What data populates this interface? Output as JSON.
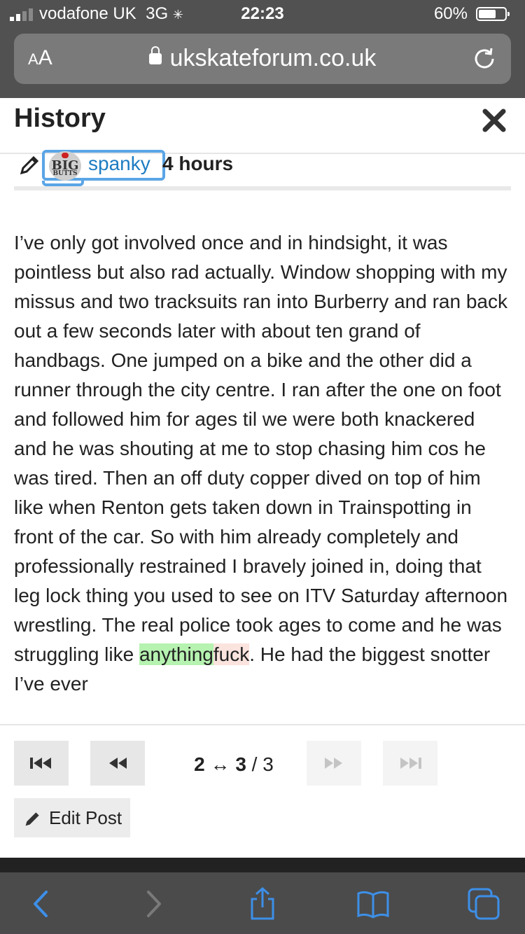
{
  "status_bar": {
    "carrier": "vodafone UK",
    "network": "3G",
    "time": "22:23",
    "battery": "60%",
    "battery_fraction": 0.6
  },
  "browser": {
    "text_size_label_small": "A",
    "text_size_label_large": "A",
    "host": "ukskateforum.co.uk"
  },
  "dialog": {
    "title": "History",
    "meta": {
      "avatar_text_top": "BIG",
      "avatar_text_bottom": "BUTTS",
      "username": "spanky",
      "time": "4 hours"
    },
    "body": {
      "before_insert": "I’ve only got involved once and in hindsight, it was pointless but also rad actually. Window shopping with my missus and two tracksuits ran into Burberry and ran back out a few seconds later with about ten grand of handbags. One jumped on a bike and the other did a runner through the city centre. I ran after the one on foot and followed him for ages til we were both knackered and he was shouting at me to stop chasing him cos he was tired. Then an off duty copper dived on top of him like when Renton gets taken down in Trainspotting in front of the car. So with him already completely and professionally restrained I bravely joined in, doing that leg lock thing you used to see on ITV Saturday afternoon wrestling. The real police took ages to come and he was struggling like ",
      "inserted": "anything",
      "deleted": "fuck",
      "after": ". He had the biggest snotter I’ve ever"
    },
    "pager": {
      "from": "2",
      "arrow": "↔",
      "to": "3",
      "separator": "/",
      "total": "3"
    },
    "edit_label": "Edit Post"
  }
}
